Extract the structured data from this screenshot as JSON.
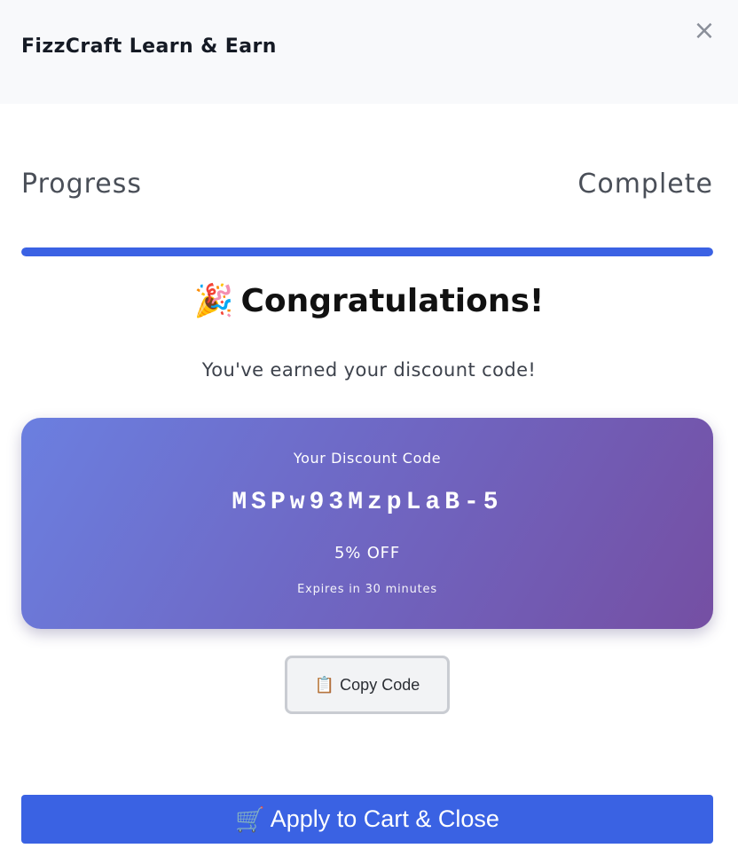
{
  "header": {
    "title": "FizzCraft Learn & Earn",
    "close_icon": "×"
  },
  "progress": {
    "label": "Progress",
    "status": "Complete",
    "percent": 100
  },
  "congrats": {
    "emoji": "🎉",
    "title": "Congratulations!",
    "subtitle": "You've earned your discount code!"
  },
  "discount": {
    "label": "Your Discount Code",
    "code": "MSPw93MzpLaB-5",
    "off": "5% OFF",
    "expires": "Expires in 30 minutes"
  },
  "actions": {
    "copy_icon": "📋",
    "copy_label": "Copy Code",
    "apply_icon": "🛒",
    "apply_label": "Apply to Cart & Close"
  },
  "colors": {
    "accent": "#3a62e3",
    "card_gradient_start": "#6b7fe0",
    "card_gradient_end": "#754fa3"
  }
}
